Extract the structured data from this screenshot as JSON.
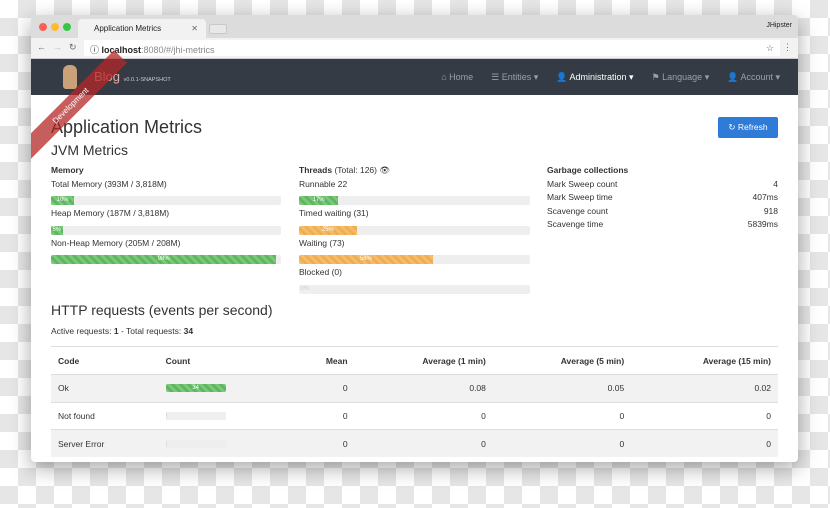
{
  "browser": {
    "tab_title": "Application Metrics",
    "user": "JHipster",
    "url_host": "localhost",
    "url_rest": ":8080/#/jhi-metrics"
  },
  "navbar": {
    "brand": "Blog",
    "version": "v0.0.1-SNAPSHOT",
    "ribbon": "Development",
    "items": [
      {
        "label": "Home",
        "icon": "home-icon"
      },
      {
        "label": "Entities",
        "icon": "list-icon"
      },
      {
        "label": "Administration",
        "icon": "user-plus-icon",
        "active": true
      },
      {
        "label": "Language",
        "icon": "flag-icon"
      },
      {
        "label": "Account",
        "icon": "user-icon"
      }
    ]
  },
  "page": {
    "title": "Application Metrics",
    "refresh": "Refresh",
    "jvm_title": "JVM Metrics"
  },
  "memory": {
    "heading": "Memory",
    "items": [
      {
        "label": "Total Memory (393M / 3,818M)",
        "percent": 10,
        "text": "10%"
      },
      {
        "label": "Heap Memory (187M / 3,818M)",
        "percent": 5,
        "text": "5%"
      },
      {
        "label": "Non-Heap Memory (205M / 208M)",
        "percent": 98,
        "text": "98%"
      }
    ]
  },
  "threads": {
    "heading": "Threads",
    "total": "(Total: 126)",
    "items": [
      {
        "label": "Runnable 22",
        "percent": 17,
        "text": "17%",
        "color": "#5cb85c"
      },
      {
        "label": "Timed waiting (31)",
        "percent": 25,
        "text": "25%",
        "color": "#f0ad4e"
      },
      {
        "label": "Waiting (73)",
        "percent": 58,
        "text": "58%",
        "color": "#f0ad4e"
      },
      {
        "label": "Blocked (0)",
        "percent": 0,
        "text": "0%",
        "color": "#5cb85c"
      }
    ]
  },
  "gc": {
    "heading": "Garbage collections",
    "rows": [
      {
        "label": "Mark Sweep count",
        "value": "4"
      },
      {
        "label": "Mark Sweep time",
        "value": "407ms"
      },
      {
        "label": "Scavenge count",
        "value": "918"
      },
      {
        "label": "Scavenge time",
        "value": "5839ms"
      }
    ]
  },
  "http": {
    "title": "HTTP requests (events per second)",
    "active_label": "Active requests: ",
    "active": "1",
    "total_label": " - Total requests: ",
    "total": "34",
    "columns": [
      "Code",
      "Count",
      "Mean",
      "Average (1 min)",
      "Average (5 min)",
      "Average (15 min)"
    ],
    "rows": [
      {
        "code": "Ok",
        "count": "34",
        "count_percent": 100,
        "mean": "0",
        "avg1": "0.08",
        "avg5": "0.05",
        "avg15": "0.02"
      },
      {
        "code": "Not found",
        "count": "",
        "count_percent": 0,
        "mean": "0",
        "avg1": "0",
        "avg5": "0",
        "avg15": "0"
      },
      {
        "code": "Server Error",
        "count": "",
        "count_percent": 0,
        "mean": "0",
        "avg1": "0",
        "avg5": "0",
        "avg15": "0"
      }
    ]
  }
}
